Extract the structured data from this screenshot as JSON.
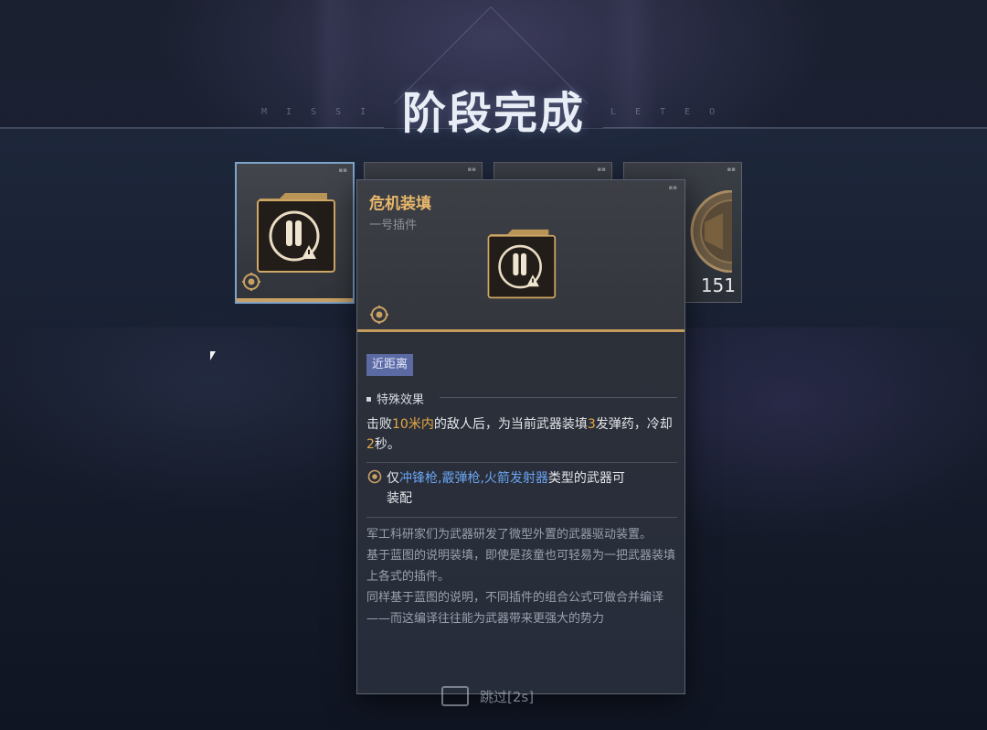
{
  "header": {
    "title": "阶段完成",
    "sub_left": "MISSI",
    "sub_right": "LETEO"
  },
  "cards": [
    {
      "name": "crisis-reload-plugin",
      "selected": true
    },
    {
      "name": "reward-2",
      "selected": false
    },
    {
      "name": "reward-3",
      "selected": false
    },
    {
      "name": "coin-reward",
      "count": "151",
      "selected": false
    }
  ],
  "tooltip": {
    "title": "危机装填",
    "subtitle": "一号插件",
    "tag": "近距离",
    "effect_header": "特殊效果",
    "effect": {
      "p1": "击败",
      "h1": "10米内",
      "p2": "的敌人后，为当前武器装填",
      "h2": "3",
      "p3": "发弹药，冷却",
      "h3": "2",
      "p4": "秒。"
    },
    "restriction": {
      "pre": "仅",
      "weapons": "冲锋枪,霰弹枪,火箭发射器",
      "post": "类型的武器可",
      "line2": "装配"
    },
    "lore": [
      "军工科研家们为武器研发了微型外置的武器驱动装置。",
      "基于蓝图的说明装填，即使是孩童也可轻易为一把武器装填上各式的插件。",
      "同样基于蓝图的说明，不同插件的组合公式可做合并编译——而这编译往往能为武器带来更强大的势力"
    ]
  },
  "skip": {
    "label": "跳过[2s]"
  },
  "colors": {
    "accent_gold": "#c39b5d",
    "highlight": "#e7a844",
    "weapon_blue": "#6aa4f2",
    "tag_bg": "#5b6aa3"
  }
}
